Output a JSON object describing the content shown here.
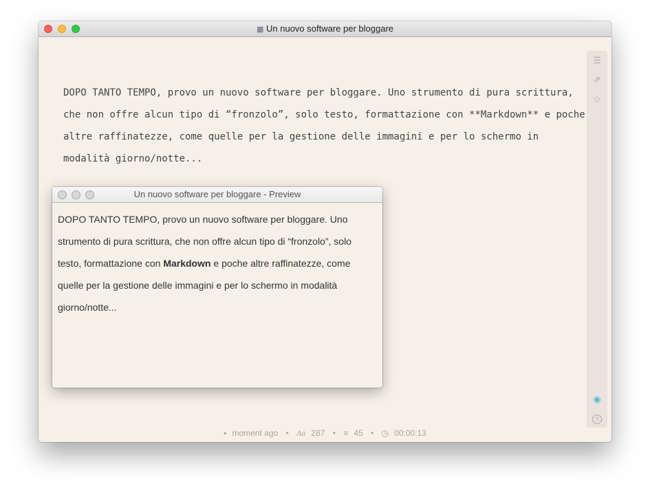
{
  "window": {
    "title": "Un nuovo software per bloggare",
    "title_icon": "typewriter-icon"
  },
  "editor": {
    "lines": [
      "DOPO TANTO TEMPO, provo un nuovo software per bloggare. Uno strumento di pura scrittura,",
      "che non offre alcun tipo di “fronzolo”, solo testo, formattazione con **Markdown** e poche",
      "altre raffinatezze, come quelle per la gestione delle immagini e per lo schermo in",
      "modalità giorno/notte..."
    ]
  },
  "sidebar": {
    "icons": [
      "list-icon",
      "share-icon",
      "export-icon",
      "eye-icon",
      "help-icon"
    ],
    "accent": "#5bb8d6"
  },
  "status": {
    "saved": "moment ago",
    "words": "287",
    "lines": "45",
    "time": "00:00:13",
    "separator": "•"
  },
  "preview": {
    "title": "Un nuovo software per bloggare - Preview",
    "line1": "DOPO TANTO TEMPO, provo un nuovo software per bloggare. Uno",
    "line2": "strumento di pura scrittura, che non offre alcun tipo di “fronzolo”, solo",
    "line3_pre": "testo, formattazione con ",
    "line3_bold": "Markdown",
    "line3_post": " e poche altre raffinatezze, come",
    "line4": "quelle per la gestione delle immagini e per lo schermo in modalità",
    "line5": "giorno/notte..."
  }
}
